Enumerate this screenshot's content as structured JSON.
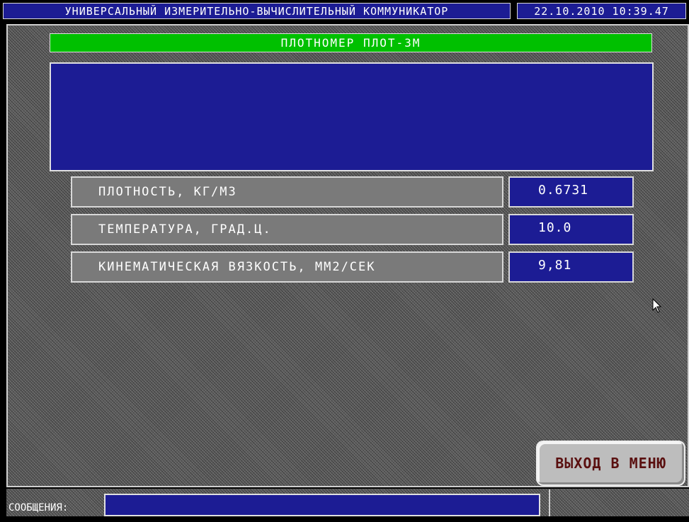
{
  "header": {
    "title": "УНИВЕРСАЛЬНЫЙ ИЗМЕРИТЕЛЬНО-ВЫЧИСЛИТЕЛЬНЫЙ КОММУНИКАТОР",
    "datetime": "22.10.2010 10:39.47"
  },
  "device": {
    "title": "ПЛОТНОМЕР   ПЛОТ-3М"
  },
  "parameters": [
    {
      "label": "ПЛОТНОСТЬ, КГ/М3",
      "value": "0.6731"
    },
    {
      "label": "ТЕМПЕРАТУРА, ГРАД.Ц.",
      "value": "10.0"
    },
    {
      "label": "КИНЕМАТИЧЕСКАЯ ВЯЗКОСТЬ, ММ2/СЕК",
      "value": "9,81"
    }
  ],
  "buttons": {
    "exit_label": "ВЫХОД В МЕНЮ"
  },
  "status": {
    "messages_label": "СООБЩЕНИЯ:",
    "messages_value": ""
  },
  "colors": {
    "panel_blue": "#1c1c94",
    "title_green": "#00c000",
    "label_gray": "#7a7a7a",
    "button_text": "#5a1010"
  }
}
